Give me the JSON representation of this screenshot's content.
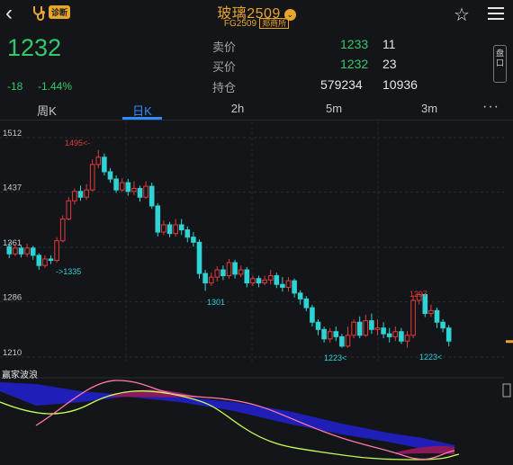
{
  "header": {
    "title": "玻璃2509",
    "code": "FG2509",
    "exchange": "郑商所",
    "diag_badge": "诊断"
  },
  "quote": {
    "last": "1232",
    "change": "-18",
    "change_pct": "-1.44%",
    "ask_label": "卖价",
    "ask_price": "1233",
    "ask_vol": "11",
    "bid_label": "买价",
    "bid_price": "1232",
    "bid_vol": "23",
    "oi_label": "持仓",
    "oi": "579234",
    "oi_chg": "10936",
    "side_badge": "盘口"
  },
  "tabs": [
    {
      "label": "周K",
      "active": false
    },
    {
      "label": "日K",
      "active": true
    },
    {
      "label": "2h",
      "active": false
    },
    {
      "label": "5m",
      "active": false
    },
    {
      "label": "3m",
      "active": false
    }
  ],
  "more_label": "···",
  "indicator": {
    "name": "赢家波浪"
  },
  "colors": {
    "up": "#e23b3b",
    "down": "#2fd3d3",
    "accent": "#e7a52d",
    "tab_active": "#2f8cff",
    "quote_green": "#33c86b"
  },
  "chart_data": {
    "type": "candlestick",
    "y_ticks": [
      "1512",
      "1437",
      "1361",
      "1286",
      "1210"
    ],
    "ylim": [
      1200,
      1525
    ],
    "annotations": [
      {
        "text": "1495<-",
        "color": "#e23b3b"
      },
      {
        "text": "->1335",
        "color": "#2fd3d3"
      },
      {
        "text": "1301",
        "color": "#2fd3d3"
      },
      {
        "text": "1223<",
        "color": "#2fd3d3"
      },
      {
        "text": "1297",
        "color": "#e23b3b"
      },
      {
        "text": "1223<",
        "color": "#2fd3d3"
      }
    ],
    "candles": [
      [
        1362,
        1352,
        1368,
        1346
      ],
      [
        1352,
        1360,
        1365,
        1349
      ],
      [
        1360,
        1352,
        1364,
        1347
      ],
      [
        1352,
        1360,
        1366,
        1348
      ],
      [
        1360,
        1350,
        1363,
        1344
      ],
      [
        1350,
        1336,
        1353,
        1330
      ],
      [
        1336,
        1345,
        1350,
        1333
      ],
      [
        1345,
        1343,
        1350,
        1338
      ],
      [
        1343,
        1370,
        1375,
        1340
      ],
      [
        1370,
        1400,
        1405,
        1368
      ],
      [
        1400,
        1425,
        1430,
        1398
      ],
      [
        1425,
        1438,
        1442,
        1420
      ],
      [
        1438,
        1430,
        1446,
        1425
      ],
      [
        1430,
        1440,
        1448,
        1426
      ],
      [
        1440,
        1475,
        1482,
        1438
      ],
      [
        1475,
        1485,
        1495,
        1470
      ],
      [
        1485,
        1465,
        1490,
        1460
      ],
      [
        1465,
        1455,
        1470,
        1450
      ],
      [
        1455,
        1440,
        1460,
        1436
      ],
      [
        1440,
        1450,
        1456,
        1437
      ],
      [
        1450,
        1438,
        1455,
        1432
      ],
      [
        1438,
        1442,
        1452,
        1433
      ],
      [
        1442,
        1430,
        1446,
        1424
      ],
      [
        1430,
        1445,
        1452,
        1428
      ],
      [
        1445,
        1418,
        1450,
        1414
      ],
      [
        1418,
        1382,
        1422,
        1376
      ],
      [
        1382,
        1392,
        1398,
        1378
      ],
      [
        1392,
        1380,
        1396,
        1375
      ],
      [
        1380,
        1392,
        1400,
        1376
      ],
      [
        1392,
        1385,
        1400,
        1378
      ],
      [
        1385,
        1375,
        1390,
        1368
      ],
      [
        1375,
        1368,
        1382,
        1362
      ],
      [
        1368,
        1325,
        1372,
        1318
      ],
      [
        1325,
        1312,
        1330,
        1301
      ],
      [
        1312,
        1320,
        1326,
        1308
      ],
      [
        1320,
        1330,
        1335,
        1314
      ],
      [
        1330,
        1322,
        1336,
        1316
      ],
      [
        1322,
        1340,
        1345,
        1318
      ],
      [
        1340,
        1324,
        1344,
        1318
      ],
      [
        1324,
        1330,
        1336,
        1320
      ],
      [
        1330,
        1312,
        1334,
        1306
      ],
      [
        1312,
        1318,
        1322,
        1308
      ],
      [
        1318,
        1312,
        1322,
        1306
      ],
      [
        1312,
        1316,
        1322,
        1309
      ],
      [
        1316,
        1322,
        1330,
        1310
      ],
      [
        1322,
        1310,
        1326,
        1305
      ],
      [
        1310,
        1306,
        1320,
        1300
      ],
      [
        1306,
        1315,
        1320,
        1300
      ],
      [
        1315,
        1298,
        1318,
        1292
      ],
      [
        1298,
        1290,
        1302,
        1282
      ],
      [
        1290,
        1278,
        1294,
        1273
      ],
      [
        1278,
        1258,
        1282,
        1252
      ],
      [
        1258,
        1248,
        1262,
        1240
      ],
      [
        1248,
        1235,
        1252,
        1230
      ],
      [
        1235,
        1245,
        1250,
        1230
      ],
      [
        1245,
        1238,
        1252,
        1232
      ],
      [
        1238,
        1225,
        1242,
        1223
      ],
      [
        1225,
        1240,
        1252,
        1223
      ],
      [
        1240,
        1258,
        1262,
        1236
      ],
      [
        1258,
        1240,
        1266,
        1236
      ],
      [
        1240,
        1260,
        1268,
        1238
      ],
      [
        1260,
        1248,
        1270,
        1242
      ],
      [
        1248,
        1250,
        1262,
        1240
      ],
      [
        1250,
        1242,
        1258,
        1236
      ],
      [
        1242,
        1238,
        1250,
        1230
      ],
      [
        1238,
        1245,
        1252,
        1232
      ],
      [
        1245,
        1232,
        1250,
        1228
      ],
      [
        1232,
        1240,
        1246,
        1223
      ],
      [
        1240,
        1288,
        1295,
        1236
      ],
      [
        1288,
        1296,
        1297,
        1282
      ],
      [
        1296,
        1270,
        1298,
        1265
      ],
      [
        1270,
        1274,
        1282,
        1265
      ],
      [
        1274,
        1258,
        1278,
        1250
      ],
      [
        1258,
        1250,
        1262,
        1244
      ],
      [
        1250,
        1232,
        1254,
        1225
      ]
    ]
  }
}
